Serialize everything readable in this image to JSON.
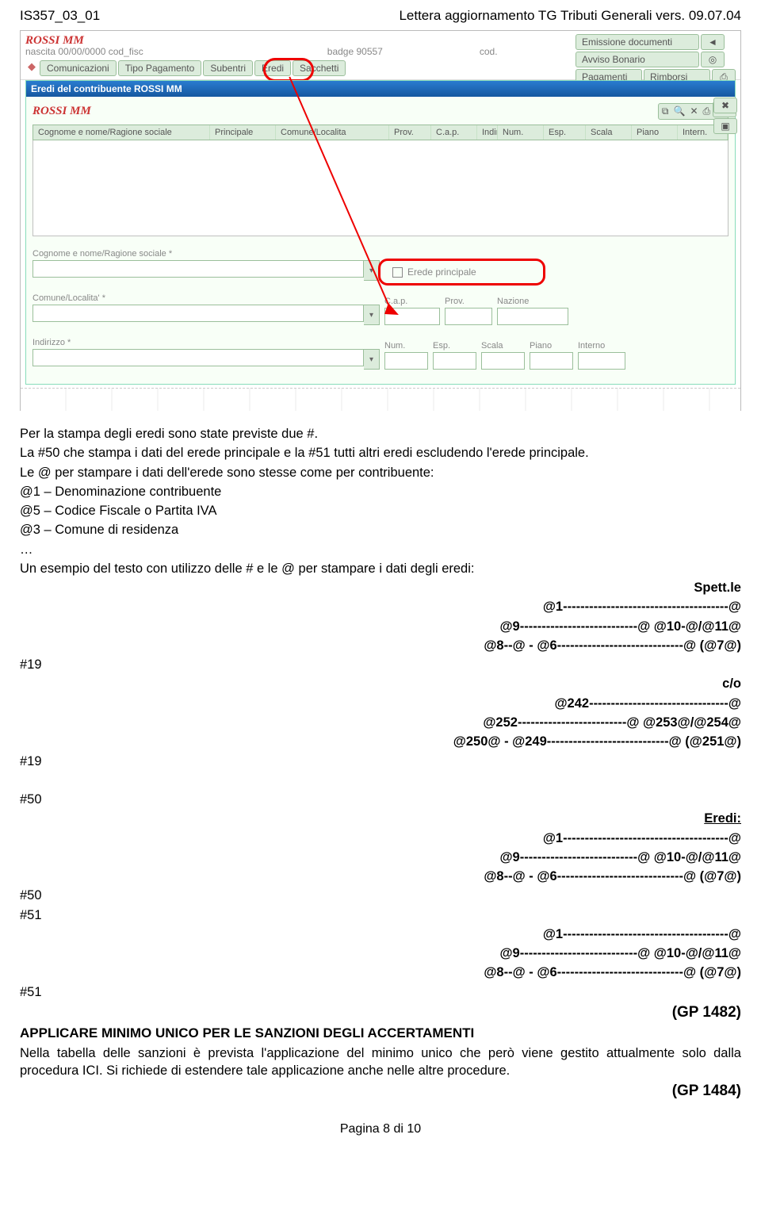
{
  "header_left": "IS357_03_01",
  "header_right": "Lettera aggiornamento TG Tributi Generali vers. 09.07.04",
  "shot": {
    "title_name": "ROSSI MM",
    "sub_row": "nascita  00/00/0000   cod_fisc",
    "badge_label": "badge 90557",
    "cod_label": "cod.",
    "tabs": [
      "Comunicazioni",
      "Tipo Pagamento",
      "Subentri",
      "Eredi",
      "Sacchetti"
    ],
    "rside": {
      "r0": [
        "Emissione documenti"
      ],
      "r1": [
        "Avviso Bonario"
      ],
      "r2": [
        "Pagamenti",
        "Rimborsi"
      ]
    },
    "modal_title": "Eredi del contribuente ROSSI MM",
    "modal_name": "ROSSI MM",
    "grid_headers": [
      "Cognome e nome/Ragione sociale",
      "Principale",
      "Comune/Localita",
      "Prov.",
      "C.a.p.",
      "Indirizzo",
      "Num.",
      "Esp.",
      "Scala",
      "Piano",
      "Intern."
    ],
    "fields": {
      "cognome_rs": "Cognome e nome/Ragione sociale *",
      "erede_principale": "Erede principale",
      "comune": "Comune/Localita' *",
      "cap": "C.a.p.",
      "prov": "Prov.",
      "nazione": "Nazione",
      "indirizzo": "Indirizzo *",
      "num": "Num.",
      "esp": "Esp.",
      "scala": "Scala",
      "piano": "Piano",
      "interno": "Interno"
    }
  },
  "para1": "Per la stampa degli eredi sono state previste due #.",
  "para2": "La #50 che stampa i dati del erede principale e la #51 tutti altri eredi escludendo l'erede principale.",
  "para3": "Le @ per stampare i dati dell'erede sono stesse come per contribuente:",
  "para4": "@1 – Denominazione contribuente",
  "para5": "@5 – Codice Fiscale o Partita IVA",
  "para6": "@3 – Comune di residenza",
  "para7": "…",
  "para8": "Un esempio del testo con utilizzo delle # e le @ per stampare i dati degli eredi:",
  "spett": "Spett.le",
  "l1": "@1--------------------------------------@",
  "l2": "@9---------------------------@ @10-@/@11@",
  "l3": "@8--@ - @6-----------------------------@ (@7@)",
  "hash19": "#19",
  "co": "c/o",
  "l4": "@242--------------------------------@",
  "l5": "@252-------------------------@ @253@/@254@",
  "l6": "@250@ - @249----------------------------@ (@251@)",
  "hash50": "#50",
  "eredi_label": "Eredi:",
  "hash51": "#51",
  "gp1": "(GP 1482)",
  "sect2_title": "APPLICARE MINIMO UNICO PER LE SANZIONI DEGLI ACCERTAMENTI",
  "sect2_body": "Nella tabella delle sanzioni è prevista l'applicazione del minimo unico che però viene gestito attualmente solo dalla procedura ICI. Si richiede di estendere tale applicazione anche nelle altre procedure.",
  "gp2": "(GP 1484)",
  "footer": "Pagina 8 di 10"
}
